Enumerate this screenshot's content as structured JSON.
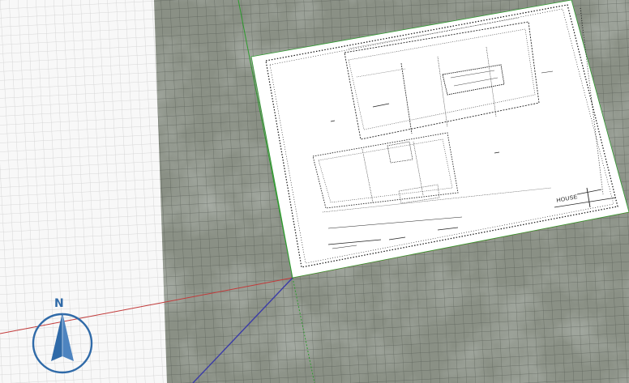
{
  "viewport": {
    "title_block_text": "HOUSE",
    "compass_label": "N"
  },
  "icons": {
    "compass": "north-compass-icon"
  },
  "colors": {
    "x_axis": "#c23a3a",
    "y_axis": "#2e9b2e",
    "z_axis": "#3b3ba8",
    "compass": "#2f6aa8",
    "terrain": "#5f665c"
  }
}
